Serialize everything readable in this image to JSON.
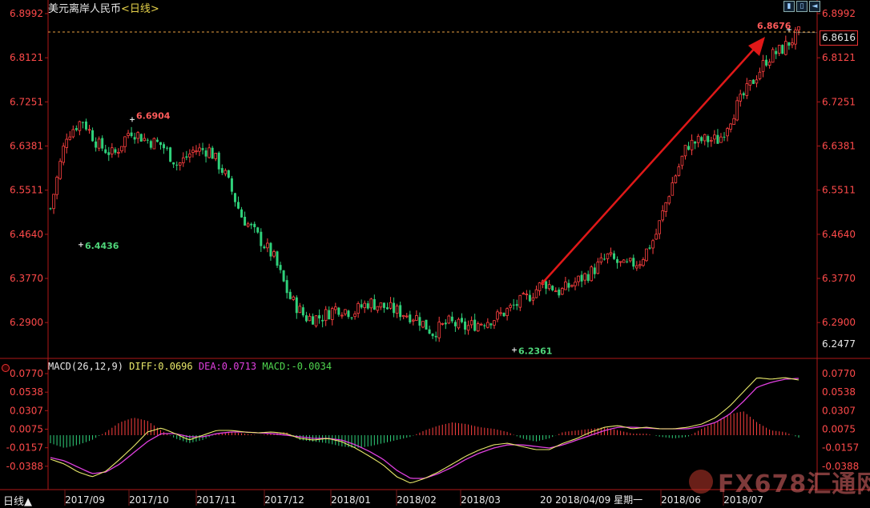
{
  "header": {
    "instrument": "美元离岸人民币",
    "period": "<日线>",
    "toolbar_icons": [
      "bar-chart-icon",
      "candle-icon",
      "back-arrow-icon"
    ]
  },
  "footer": {
    "period_tab": "日线▲",
    "cursor_date": "2018/04/09 星期一",
    "cursor_date_prefix": "20",
    "watermark": "FX678",
    "watermark_cn": "汇通网"
  },
  "colors": {
    "up": "#ff4040",
    "down": "#2fd07a",
    "diff_line": "#e8e86a",
    "dea_line": "#e040e0",
    "arrow": "#e01818",
    "axis": "#b01818"
  },
  "chart_data": [
    {
      "type": "candlestick",
      "title": "美元离岸人民币 <日线>",
      "y_ticks": [
        "6.8992",
        "6.8121",
        "6.7251",
        "6.6381",
        "6.5511",
        "6.4640",
        "6.3770",
        "6.2900"
      ],
      "y_extra_label": "6.2477",
      "ylim": [
        6.2477,
        6.8992
      ],
      "x_ticks": [
        "2017/09",
        "2017/10",
        "2017/11",
        "2017/12",
        "2018/01",
        "2018/02",
        "2018/03",
        "2018/06",
        "2018/07"
      ],
      "last_price": "6.8616",
      "annotations": [
        {
          "label": "6.6904",
          "value": 6.6904,
          "type": "high",
          "period": "2017/10"
        },
        {
          "label": "6.4436",
          "value": 6.4436,
          "type": "low",
          "period": "2017/09"
        },
        {
          "label": "6.2361",
          "value": 6.2361,
          "type": "low",
          "period": "2018/04"
        },
        {
          "label": "6.8676",
          "value": 6.8676,
          "type": "high",
          "period": "2018/08"
        }
      ],
      "trend_path": [
        6.515,
        6.66,
        6.69,
        6.64,
        6.62,
        6.67,
        6.65,
        6.64,
        6.6,
        6.63,
        6.63,
        6.58,
        6.5,
        6.46,
        6.42,
        6.34,
        6.3,
        6.3,
        6.32,
        6.31,
        6.33,
        6.32,
        6.31,
        6.3,
        6.27,
        6.29,
        6.28,
        6.29,
        6.3,
        6.32,
        6.34,
        6.37,
        6.35,
        6.37,
        6.39,
        6.42,
        6.4,
        6.41,
        6.46,
        6.56,
        6.64,
        6.65,
        6.65,
        6.71,
        6.76,
        6.81,
        6.83,
        6.86
      ]
    },
    {
      "type": "macd",
      "title": "MACD(26,12,9)",
      "diff_label": "DIFF:0.0696",
      "dea_label": "DEA:0.0713",
      "macd_label": "MACD:-0.0034",
      "y_ticks": [
        "0.0770",
        "0.0538",
        "0.0307",
        "0.0075",
        "-0.0157",
        "-0.0388"
      ],
      "ylim": [
        -0.06,
        0.077
      ],
      "diff": [
        -0.03,
        -0.036,
        -0.046,
        -0.052,
        -0.045,
        -0.03,
        -0.014,
        0.004,
        0.009,
        0.002,
        -0.006,
        0.0,
        0.006,
        0.006,
        0.004,
        0.003,
        0.004,
        0.002,
        -0.004,
        -0.006,
        -0.004,
        -0.008,
        -0.016,
        -0.026,
        -0.037,
        -0.052,
        -0.06,
        -0.054,
        -0.046,
        -0.036,
        -0.026,
        -0.018,
        -0.012,
        -0.01,
        -0.014,
        -0.018,
        -0.018,
        -0.01,
        -0.004,
        0.004,
        0.01,
        0.012,
        0.008,
        0.01,
        0.008,
        0.008,
        0.01,
        0.014,
        0.022,
        0.036,
        0.054,
        0.072,
        0.07,
        0.072,
        0.069
      ],
      "dea": [
        -0.028,
        -0.032,
        -0.04,
        -0.048,
        -0.046,
        -0.036,
        -0.022,
        -0.008,
        0.002,
        0.002,
        -0.002,
        -0.002,
        0.002,
        0.004,
        0.004,
        0.003,
        0.002,
        0.0,
        -0.002,
        -0.004,
        -0.004,
        -0.006,
        -0.012,
        -0.02,
        -0.03,
        -0.044,
        -0.054,
        -0.054,
        -0.048,
        -0.04,
        -0.03,
        -0.022,
        -0.016,
        -0.012,
        -0.012,
        -0.014,
        -0.016,
        -0.012,
        -0.006,
        0.0,
        0.006,
        0.01,
        0.01,
        0.009,
        0.008,
        0.008,
        0.008,
        0.011,
        0.016,
        0.026,
        0.042,
        0.06,
        0.066,
        0.07,
        0.071
      ],
      "hist": [
        -0.01,
        -0.016,
        -0.012,
        -0.006,
        0.004,
        0.016,
        0.022,
        0.018,
        0.006,
        -0.004,
        -0.01,
        -0.006,
        0.002,
        0.004,
        0.002,
        0.0,
        0.002,
        0.004,
        -0.006,
        -0.008,
        -0.01,
        -0.014,
        -0.016,
        -0.014,
        -0.01,
        -0.006,
        -0.002,
        0.006,
        0.012,
        0.016,
        0.014,
        0.01,
        0.008,
        0.004,
        -0.004,
        -0.008,
        -0.004,
        0.004,
        0.006,
        0.008,
        0.01,
        0.006,
        0.002,
        0.002,
        -0.002,
        -0.004,
        -0.002,
        0.008,
        0.016,
        0.026,
        0.03,
        0.016,
        0.006,
        0.004,
        -0.003
      ]
    }
  ]
}
